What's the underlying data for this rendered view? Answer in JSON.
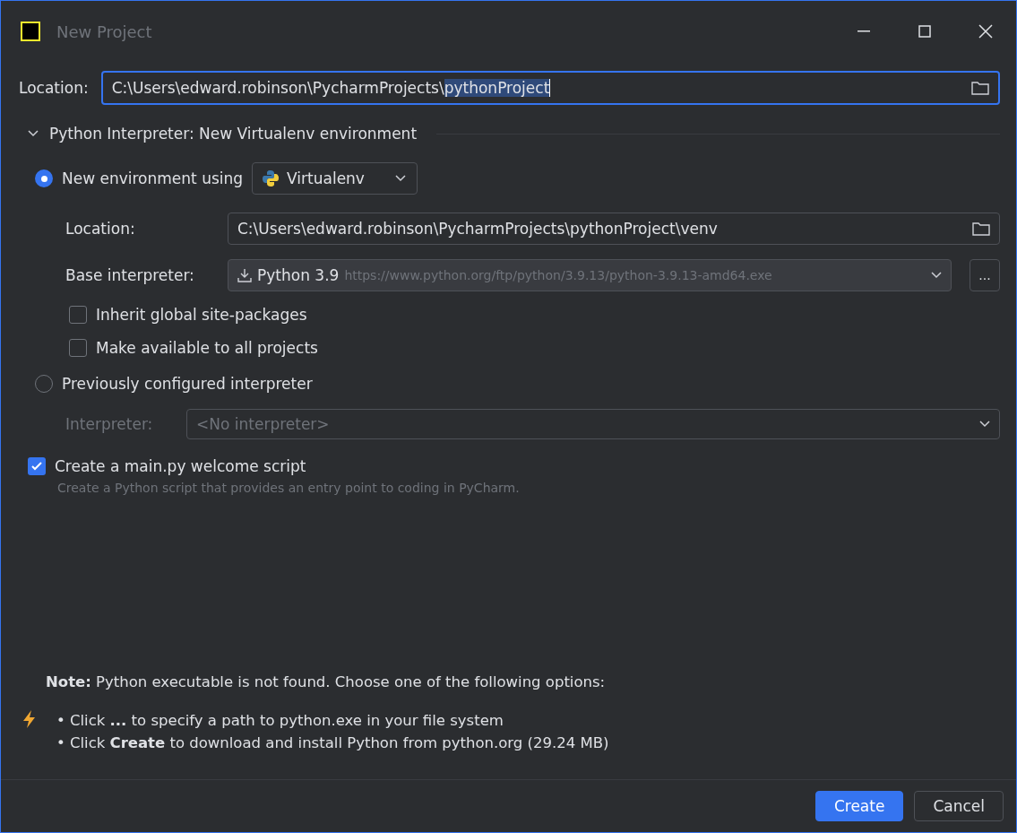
{
  "window": {
    "title": "New Project"
  },
  "location": {
    "label": "Location:",
    "value_unselected": "C:\\Users\\edward.robinson\\PycharmProjects\\",
    "value_selected": "pythonProject"
  },
  "section": {
    "title": "Python Interpreter: New Virtualenv environment",
    "expanded": true
  },
  "new_env": {
    "label": "New environment using",
    "selected": true,
    "tool": "Virtualenv",
    "location_label": "Location:",
    "location_value": "C:\\Users\\edward.robinson\\PycharmProjects\\pythonProject\\venv",
    "base_label": "Base interpreter:",
    "base_value": "Python 3.9",
    "base_hint": "https://www.python.org/ftp/python/3.9.13/python-3.9.13-amd64.exe",
    "browse": "...",
    "options": [
      {
        "label": "Inherit global site-packages",
        "checked": false
      },
      {
        "label": "Make available to all projects",
        "checked": false
      }
    ]
  },
  "previous": {
    "label": "Previously configured interpreter",
    "selected": false,
    "interpreter_label": "Interpreter:",
    "interpreter_value": "<No interpreter>",
    "disabled": true
  },
  "welcome": {
    "label": "Create a main.py welcome script",
    "checked": true,
    "description": "Create a Python script that provides an entry point to coding in PyCharm."
  },
  "note": {
    "text": "**Note:** Python executable is not found. Choose one of the following options:",
    "bullets": [
      "• Click **...** to specify a path to python.exe in your file system",
      "• Click **Create** to download and install Python from python.org (29.24 MB)"
    ]
  },
  "buttons": [
    {
      "label": "Create",
      "kind": "primary"
    },
    {
      "label": "Cancel",
      "kind": "secondary"
    }
  ]
}
